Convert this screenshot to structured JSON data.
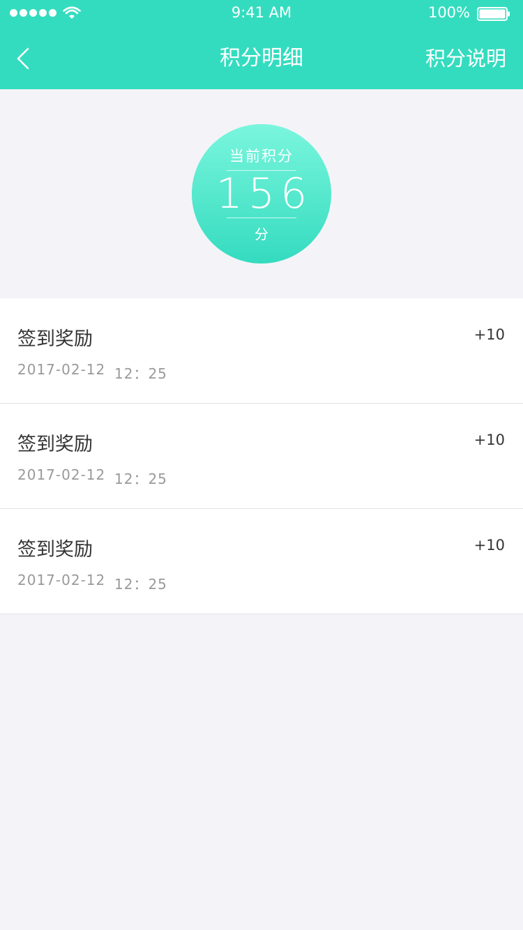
{
  "status_bar": {
    "time": "9:41 AM",
    "battery": "100%"
  },
  "nav": {
    "title": "积分明细",
    "right_action": "积分说明"
  },
  "points": {
    "label": "当前积分",
    "value": "156",
    "unit": "分"
  },
  "records": [
    {
      "title": "签到奖励",
      "points": "+10",
      "date": "2017-02-12",
      "time": "12：25"
    },
    {
      "title": "签到奖励",
      "points": "+10",
      "date": "2017-02-12",
      "time": "12：25"
    },
    {
      "title": "签到奖励",
      "points": "+10",
      "date": "2017-02-12",
      "time": "12：25"
    }
  ],
  "colors": {
    "brand": "#34dcbf",
    "background": "#f4f4f8"
  }
}
